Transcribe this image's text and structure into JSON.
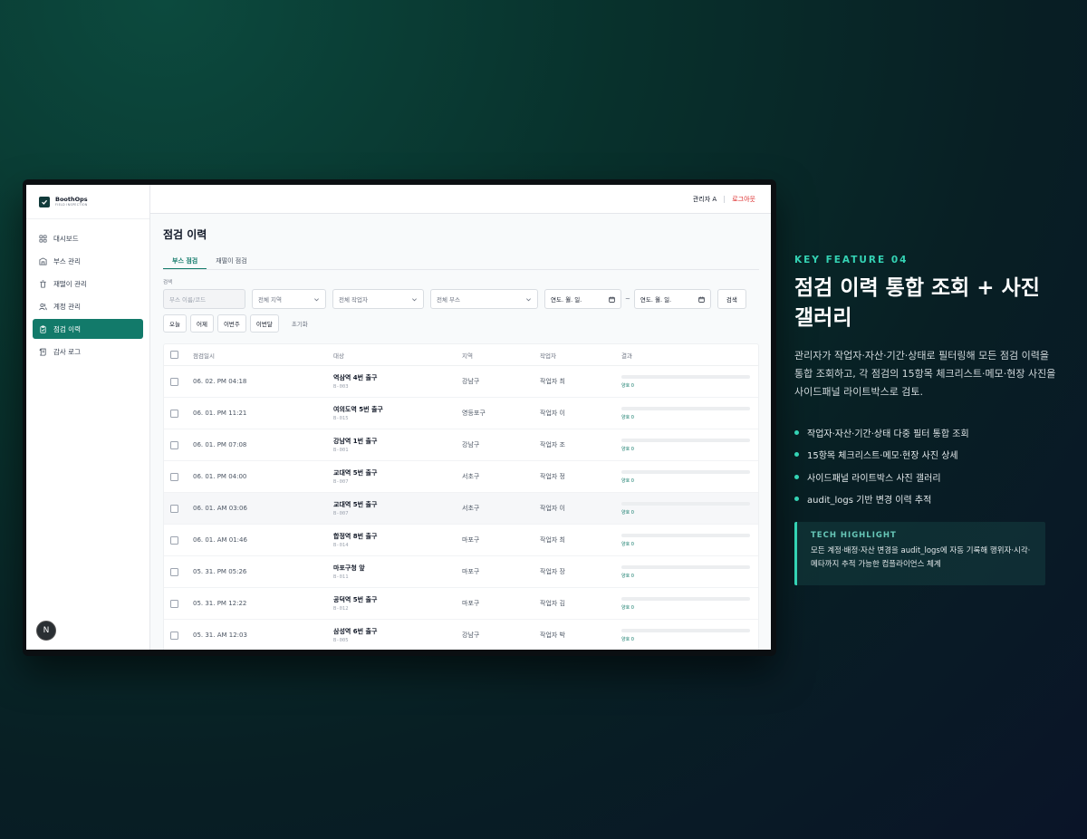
{
  "app": {
    "brand_name": "BoothOps",
    "brand_sub": "FIELD INSPECTION",
    "user": "관리자 A",
    "logout": "로그아웃",
    "badge": "N"
  },
  "sidebar": {
    "items": [
      {
        "label": "대시보드",
        "icon": "grid-icon"
      },
      {
        "label": "부스 관리",
        "icon": "building-icon"
      },
      {
        "label": "재떨이 관리",
        "icon": "trash-icon"
      },
      {
        "label": "계정 관리",
        "icon": "users-icon"
      },
      {
        "label": "점검 이력",
        "icon": "clipboard-check-icon"
      },
      {
        "label": "감사 로그",
        "icon": "scroll-icon"
      }
    ],
    "active_index": 4
  },
  "page": {
    "title": "점검 이력",
    "tabs": [
      "부스 점검",
      "재떨이 점검"
    ],
    "search_label": "검색",
    "filters": {
      "booth_placeholder": "부스 이름/코드",
      "region": "전체 지역",
      "worker": "전체 작업자",
      "booth": "전체 부스",
      "date_from": "연도. 월. 일.",
      "date_to": "연도. 월. 일.",
      "tilde": "~",
      "search_btn": "검색"
    },
    "quick": [
      "오늘",
      "어제",
      "이번주",
      "이번달"
    ],
    "reset": "초기화"
  },
  "table": {
    "columns": [
      "점검일시",
      "대상",
      "지역",
      "작업자",
      "결과"
    ],
    "rows": [
      {
        "date": "06. 02. PM 04:18",
        "name": "역삼역 4번 출구",
        "code": "B-003",
        "region": "강남구",
        "worker": "작업자 최",
        "result": "양호 0"
      },
      {
        "date": "06. 01. PM 11:21",
        "name": "여의도역 5번 출구",
        "code": "B-015",
        "region": "영등포구",
        "worker": "작업자 이",
        "result": "양호 0"
      },
      {
        "date": "06. 01. PM 07:08",
        "name": "강남역 1번 출구",
        "code": "B-001",
        "region": "강남구",
        "worker": "작업자 조",
        "result": "양호 0"
      },
      {
        "date": "06. 01. PM 04:00",
        "name": "교대역 5번 출구",
        "code": "B-007",
        "region": "서초구",
        "worker": "작업자 정",
        "result": "양호 0"
      },
      {
        "date": "06. 01. AM 03:06",
        "name": "교대역 5번 출구",
        "code": "B-007",
        "region": "서초구",
        "worker": "작업자 이",
        "result": "양호 0"
      },
      {
        "date": "06. 01. AM 01:46",
        "name": "합정역 8번 출구",
        "code": "B-014",
        "region": "마포구",
        "worker": "작업자 최",
        "result": "양호 0"
      },
      {
        "date": "05. 31. PM 05:26",
        "name": "마포구청 앞",
        "code": "B-011",
        "region": "마포구",
        "worker": "작업자 장",
        "result": "양호 0"
      },
      {
        "date": "05. 31. PM 12:22",
        "name": "공덕역 5번 출구",
        "code": "B-012",
        "region": "마포구",
        "worker": "작업자 김",
        "result": "양호 0"
      },
      {
        "date": "05. 31. AM 12:03",
        "name": "삼성역 6번 출구",
        "code": "B-005",
        "region": "강남구",
        "worker": "작업자 박",
        "result": "양호 0"
      }
    ]
  },
  "feature": {
    "kicker": "KEY FEATURE 04",
    "title": "점검 이력 통합 조회 + 사진 갤러리",
    "desc": "관리자가 작업자·자산·기간·상태로 필터링해 모든 점검 이력을 통합 조회하고, 각 점검의 15항목 체크리스트·메모·현장 사진을 사이드패널 라이트박스로 검토.",
    "bullets": [
      "작업자·자산·기간·상태 다중 필터 통합 조회",
      "15항목 체크리스트·메모·현장 사진 상세",
      "사이드패널 라이트박스 사진 갤러리",
      "audit_logs 기반 변경 이력 추적"
    ],
    "highlight_title": "TECH HIGHLIGHT",
    "highlight_text": "모든 계정·배정·자산 변경을 audit_logs에 자동 기록해 행위자·시각·메타까지 추적 가능한 컴플라이언스 체계"
  },
  "colors": {
    "accent": "#127a6a",
    "accent_light": "#34d3b4",
    "logout": "#dc2626"
  }
}
